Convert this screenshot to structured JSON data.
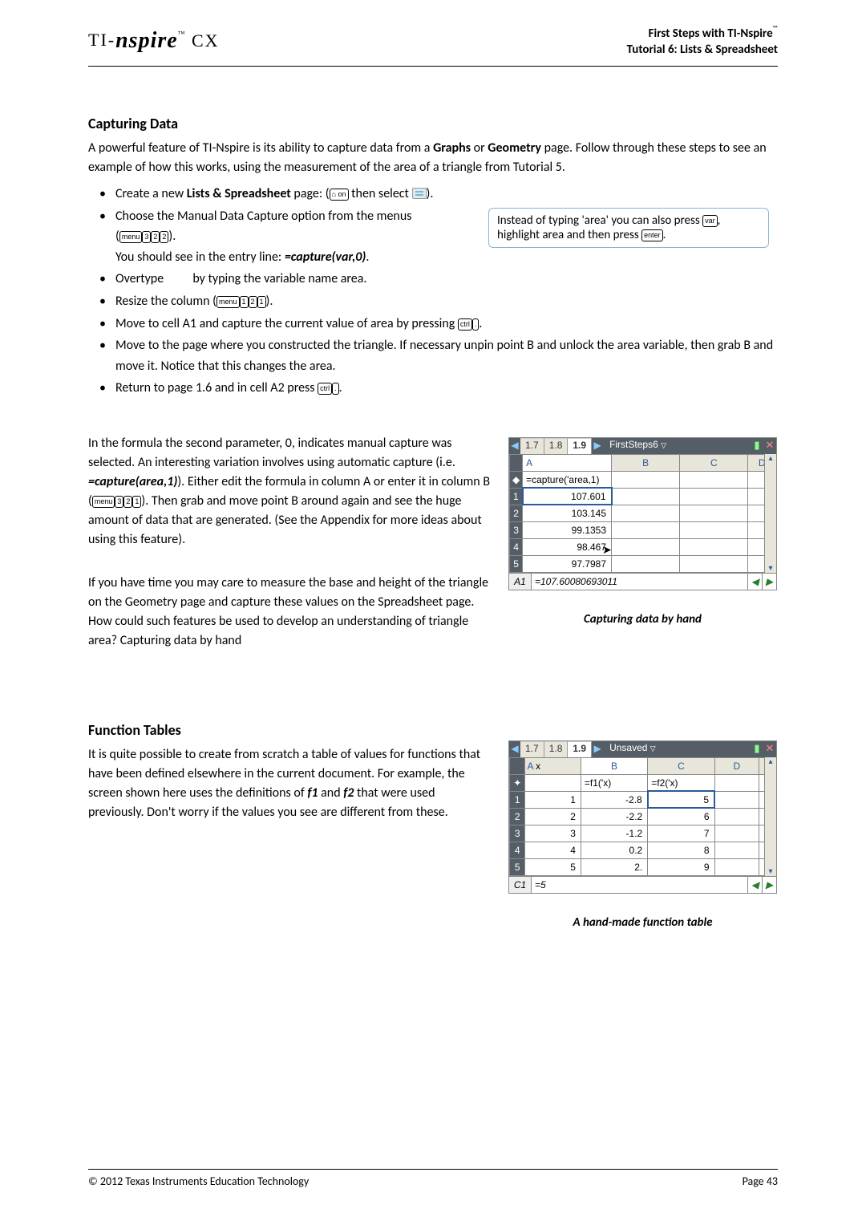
{
  "header": {
    "logo_ti": "TI-",
    "logo_nspire": "nspire",
    "logo_tm": "™",
    "logo_cx": " CX",
    "line1a": "First Steps with TI-Nspire",
    "line1tm": "™",
    "line2": "Tutorial 6: Lists & Spreadsheet"
  },
  "sec1_title": "Capturing Data",
  "sec1_intro_a": "A powerful feature of TI-Nspire is its ability to capture data from a ",
  "sec1_intro_b": "Graphs",
  "sec1_intro_c": " or ",
  "sec1_intro_d": "Geometry",
  "sec1_intro_e": " page.  Follow through these steps to see an example of how this works, using the measurement of the area of a triangle from Tutorial 5.",
  "steps": {
    "s1a": "Create a new ",
    "s1b": "Lists & Spreadsheet",
    "s1c": " page: (",
    "s1d": " then select ",
    "s1e": ").",
    "s2a": "Choose the Manual Data Capture option from the menus",
    "s2b": "(",
    "s2c": ").",
    "s2d": "You should see in the entry line: ",
    "s2e": "=capture(var,0)",
    "s2f": ".",
    "s3a1": "Overtype",
    "s3a2": "          by typing the variable name area.",
    "s4a": "Resize the column (",
    "s4b": ").",
    "s5a": "Move to cell A1 and capture the current value of area by pressing ",
    "s5b": ".",
    "s6": "Move to the page where you constructed the triangle. If necessary unpin point B and unlock the area variable, then grab B and move it. Notice that this changes the area.",
    "s7a": "Return to page 1.6 and in cell A2 press ",
    "s7b": "."
  },
  "tip": {
    "a": "Instead of typing 'area' you can also press ",
    "b": ", highlight area and then press ",
    "c": "."
  },
  "keys": {
    "menu": "menu",
    "three": "3",
    "two": "2",
    "one": "1",
    "ctrl": "ctrl",
    "dot": ".",
    "var": "var",
    "enter": "enter",
    "home": "⌂ on"
  },
  "para2a": "In the formula the second parameter, 0, indicates manual capture was selected. An interesting variation involves using automatic capture (i.e. ",
  "para2b": "=capture(area,1)",
  "para2c": "). Either edit the formula in column A or enter it in column B (",
  "para2d": "). Then grab and move point B around again and see the huge amount of data that are generated. (See the Appendix for more ideas about using this feature).",
  "para3a": "If you have time you may care to measure the base and height of the triangle on the Geometry page and capture these values on the Spreadsheet page. How could such features be used to develop an understanding of triangle area? Capturing data by hand",
  "shot1": {
    "tabs": [
      "1.7",
      "1.8",
      "1.9"
    ],
    "doc": "FirstSteps6",
    "cols": [
      "A",
      "B",
      "C",
      "D"
    ],
    "formula": "=capture('area,1)",
    "rows": [
      "107.601",
      "103.145",
      "99.1353",
      "98.467",
      "97.7987"
    ],
    "cell": "A1",
    "entry": "=107.60080693011",
    "caption": "Capturing data by hand"
  },
  "sec2_title": "Function Tables",
  "sec2_para_a": "It is quite possible to create from scratch a table of values for functions that have been defined elsewhere in the current document. For example, the screen shown here uses the definitions of ",
  "sec2_para_b": "f1",
  "sec2_para_c": " and ",
  "sec2_para_d": "f2",
  "sec2_para_e": " that were used previously. Don't worry if the values you see are different from these.",
  "shot2": {
    "tabs": [
      "1.7",
      "1.8",
      "1.9"
    ],
    "doc": "Unsaved",
    "colnames": [
      "A",
      "B",
      "C",
      "D"
    ],
    "colvar": "x",
    "formulas": [
      "=f1('x)",
      "=f2('x)"
    ],
    "rows": [
      [
        "1",
        "-2.8",
        "5"
      ],
      [
        "2",
        "-2.2",
        "6"
      ],
      [
        "3",
        "-1.2",
        "7"
      ],
      [
        "4",
        "0.2",
        "8"
      ],
      [
        "5",
        "2.",
        "9"
      ]
    ],
    "cell": "C1",
    "entry": "=5",
    "caption": "A hand-made function table"
  },
  "footer": {
    "left": "© 2012 Texas Instruments Education Technology",
    "right": "Page  43"
  }
}
